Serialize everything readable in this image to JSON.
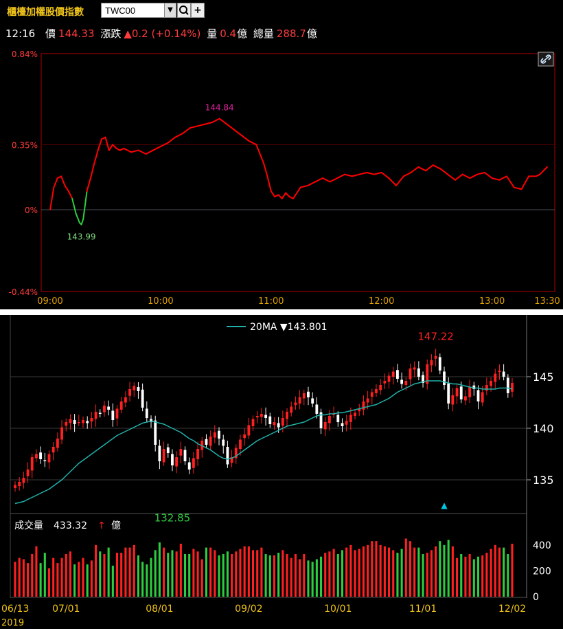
{
  "header": {
    "index_name": "櫃檯加權股價指數",
    "symbol": "TWC00",
    "dropdown_icon": "chevron-down-icon",
    "search_icon": "search-icon",
    "add_icon": "plus-icon"
  },
  "quote": {
    "time": "12:16",
    "price_label": "價",
    "price": "144.33",
    "change_label": "漲跌",
    "change": "▲0.2 (+0.14%)",
    "volume_label": "量",
    "volume": "0.4",
    "volume_unit": "億",
    "total_volume_label": "總量",
    "total_volume": "288.7",
    "total_volume_unit": "億"
  },
  "colors": {
    "up": "#ff2020",
    "down": "#2ecc40",
    "line": "#ff0000",
    "ma": "#20b2aa",
    "frame_intraday": "#b00000",
    "axis_label_intraday": "#e0a000"
  },
  "chart_data": [
    {
      "type": "line",
      "name": "intraday",
      "y_ticks": [
        "0.84%",
        "0.35%",
        "0%",
        "-0.44%"
      ],
      "y_tick_values": [
        0.84,
        0.35,
        0,
        -0.44
      ],
      "x_ticks": [
        "09:00",
        "10:00",
        "11:00",
        "12:00",
        "13:00",
        "13:30"
      ],
      "x_tick_minutes": [
        0,
        60,
        120,
        180,
        240,
        270
      ],
      "ylim": [
        -0.44,
        0.84
      ],
      "annotations": [
        {
          "text": "144.84",
          "minute": 92,
          "value": 0.49
        },
        {
          "text": "143.99",
          "minute": 17,
          "value": -0.08
        }
      ],
      "x_minutes": [
        0,
        2,
        4,
        6,
        8,
        10,
        12,
        14,
        16,
        17,
        18,
        20,
        22,
        24,
        26,
        28,
        30,
        32,
        34,
        36,
        38,
        40,
        44,
        48,
        52,
        56,
        60,
        64,
        68,
        72,
        76,
        80,
        84,
        88,
        92,
        96,
        100,
        104,
        108,
        112,
        116,
        118,
        120,
        122,
        124,
        126,
        128,
        130,
        132,
        136,
        140,
        144,
        148,
        152,
        156,
        160,
        164,
        168,
        172,
        176,
        180,
        184,
        188,
        192,
        196,
        200,
        204,
        208,
        212,
        216,
        220,
        224,
        228,
        232,
        236,
        240,
        244,
        248,
        252,
        256,
        260,
        264,
        266,
        270
      ],
      "values": [
        0.0,
        0.12,
        0.17,
        0.18,
        0.13,
        0.1,
        0.06,
        -0.02,
        -0.07,
        -0.08,
        -0.05,
        0.1,
        0.17,
        0.25,
        0.32,
        0.38,
        0.39,
        0.32,
        0.35,
        0.33,
        0.32,
        0.33,
        0.31,
        0.32,
        0.3,
        0.32,
        0.34,
        0.36,
        0.39,
        0.41,
        0.44,
        0.45,
        0.46,
        0.47,
        0.49,
        0.46,
        0.43,
        0.4,
        0.37,
        0.35,
        0.25,
        0.18,
        0.1,
        0.07,
        0.08,
        0.06,
        0.09,
        0.07,
        0.06,
        0.12,
        0.13,
        0.15,
        0.17,
        0.15,
        0.17,
        0.19,
        0.18,
        0.19,
        0.2,
        0.19,
        0.2,
        0.17,
        0.13,
        0.18,
        0.2,
        0.23,
        0.21,
        0.24,
        0.22,
        0.19,
        0.16,
        0.19,
        0.17,
        0.19,
        0.2,
        0.17,
        0.16,
        0.18,
        0.12,
        0.11,
        0.18,
        0.18,
        0.19,
        0.23
      ],
      "series_color_up": "#ff0000",
      "series_color_down": "#2ecc40",
      "grid": true
    },
    {
      "type": "candlestick",
      "name": "daily",
      "legend": "20MA ▼143.801",
      "y_ticks": [
        "145",
        "140",
        "135"
      ],
      "y_tick_values": [
        145,
        140,
        135
      ],
      "ylim": [
        132,
        149
      ],
      "x_ticks": [
        "06/13",
        "07/01",
        "08/01",
        "09/02",
        "10/01",
        "11/01",
        "12/02"
      ],
      "x_tick_index": [
        0,
        12,
        34,
        55,
        76,
        96,
        117
      ],
      "x_year_label": "2019",
      "annotations": [
        {
          "text": "147.22",
          "index": 99,
          "value": 147.22,
          "color": "#ff2020"
        },
        {
          "text": "132.85",
          "index": 37,
          "value": 132.85,
          "color": "#2ecc40"
        }
      ],
      "marker": {
        "symbol": "▲",
        "index": 101,
        "value": 132.6,
        "color": "#00c8e0"
      },
      "close": [
        134.5,
        134.8,
        135.2,
        136.0,
        137.2,
        137.5,
        137.0,
        136.8,
        137.5,
        138.2,
        139.0,
        140.1,
        140.6,
        140.9,
        140.4,
        140.6,
        140.8,
        140.5,
        141.0,
        141.6,
        141.4,
        142.2,
        141.8,
        140.8,
        141.9,
        142.6,
        143.0,
        143.8,
        144.1,
        143.6,
        142.0,
        141.0,
        140.6,
        138.4,
        136.8,
        138.0,
        137.6,
        136.4,
        137.2,
        138.0,
        136.8,
        136.0,
        137.1,
        138.0,
        138.8,
        138.4,
        139.2,
        139.6,
        139.0,
        138.3,
        136.5,
        137.2,
        138.1,
        138.9,
        139.4,
        140.3,
        140.9,
        141.2,
        141.4,
        141.0,
        140.4,
        140.6,
        140.1,
        141.0,
        141.6,
        142.1,
        142.5,
        143.0,
        143.4,
        143.0,
        142.4,
        141.4,
        140.0,
        140.6,
        141.2,
        141.4,
        140.6,
        140.2,
        140.7,
        141.3,
        141.5,
        141.9,
        142.6,
        142.9,
        143.5,
        143.8,
        144.2,
        144.6,
        145.1,
        145.5,
        144.8,
        144.3,
        144.6,
        145.8,
        145.9,
        145.0,
        144.4,
        146.2,
        146.6,
        147.0,
        145.6,
        144.2,
        142.4,
        143.2,
        143.9,
        142.8,
        143.1,
        144.0,
        143.8,
        142.6,
        143.5,
        144.2,
        144.6,
        145.3,
        145.6,
        145.0,
        143.4,
        144.4
      ],
      "ma20": [
        132.7,
        132.8,
        132.9,
        133.1,
        133.3,
        133.5,
        133.7,
        133.9,
        134.1,
        134.4,
        134.7,
        135.0,
        135.4,
        135.8,
        136.2,
        136.6,
        136.9,
        137.2,
        137.5,
        137.8,
        138.1,
        138.4,
        138.7,
        139.0,
        139.3,
        139.5,
        139.7,
        139.9,
        140.1,
        140.3,
        140.5,
        140.6,
        140.7,
        140.6,
        140.5,
        140.4,
        140.2,
        140.0,
        139.8,
        139.6,
        139.3,
        139.0,
        138.8,
        138.5,
        138.3,
        138.1,
        137.9,
        137.6,
        137.3,
        137.1,
        137.0,
        137.1,
        137.3,
        137.6,
        137.9,
        138.2,
        138.5,
        138.8,
        139.0,
        139.2,
        139.4,
        139.6,
        139.8,
        140.0,
        140.2,
        140.3,
        140.4,
        140.5,
        140.6,
        140.8,
        141.0,
        141.2,
        141.3,
        141.3,
        141.4,
        141.4,
        141.5,
        141.5,
        141.6,
        141.7,
        141.8,
        141.9,
        142.0,
        142.1,
        142.2,
        142.3,
        142.5,
        142.7,
        142.9,
        143.2,
        143.5,
        143.7,
        143.9,
        144.1,
        144.3,
        144.4,
        144.5,
        144.6,
        144.6,
        144.6,
        144.6,
        144.5,
        144.4,
        144.3,
        144.3,
        144.2,
        144.1,
        144.0,
        143.9,
        143.9,
        143.8,
        143.8,
        143.8,
        143.8,
        143.9,
        143.9,
        143.9,
        143.8
      ],
      "volume_label": "成交量",
      "volume_value": "433.32",
      "volume_arrow": "↑",
      "volume_unit": "億",
      "volume_ticks": [
        "400",
        "200",
        "0"
      ],
      "volume_tick_values": [
        400,
        200,
        0
      ],
      "volume_ylim": [
        0,
        500
      ],
      "volume": [
        270,
        300,
        290,
        260,
        330,
        390,
        260,
        340,
        220,
        300,
        260,
        300,
        330,
        350,
        250,
        270,
        300,
        250,
        280,
        400,
        350,
        330,
        380,
        240,
        340,
        340,
        380,
        380,
        400,
        320,
        270,
        250,
        300,
        360,
        420,
        380,
        340,
        360,
        350,
        410,
        330,
        330,
        370,
        350,
        290,
        380,
        380,
        360,
        320,
        330,
        350,
        330,
        350,
        370,
        390,
        390,
        360,
        360,
        380,
        330,
        320,
        320,
        340,
        360,
        330,
        300,
        330,
        290,
        330,
        280,
        270,
        290,
        310,
        340,
        350,
        370,
        330,
        360,
        380,
        400,
        360,
        370,
        390,
        400,
        430,
        430,
        400,
        390,
        380,
        360,
        340,
        370,
        450,
        430,
        380,
        380,
        330,
        340,
        360,
        390,
        430,
        400,
        440,
        390,
        300,
        330,
        310,
        330,
        290,
        310,
        320,
        340,
        370,
        400,
        380,
        380,
        330,
        410
      ]
    }
  ]
}
